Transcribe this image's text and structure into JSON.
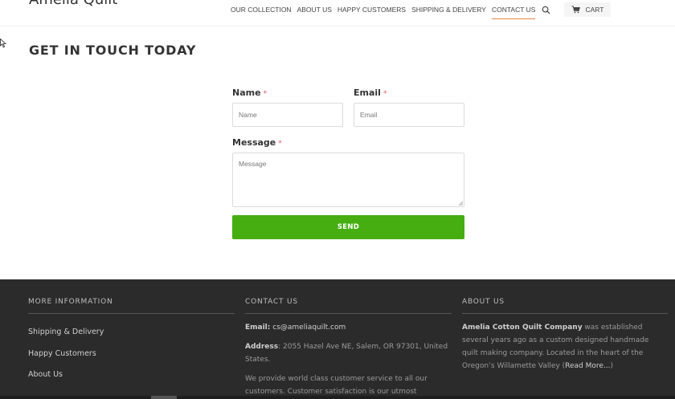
{
  "header": {
    "logo": "Amelia Quilt",
    "nav": [
      {
        "label": "OUR COLLECTION"
      },
      {
        "label": "ABOUT US"
      },
      {
        "label": "HAPPY CUSTOMERS"
      },
      {
        "label": "SHIPPING & DELIVERY"
      },
      {
        "label": "CONTACT US"
      }
    ],
    "cart_label": "CART",
    "accent_color": "#e9864c"
  },
  "page": {
    "title": "GET IN TOUCH TODAY"
  },
  "form": {
    "name_label": "Name",
    "name_placeholder": "Name",
    "email_label": "Email",
    "email_placeholder": "Email",
    "message_label": "Message",
    "message_placeholder": "Message",
    "required_mark": "*",
    "send_label": "SEND",
    "button_color": "#46ae10"
  },
  "footer": {
    "more_info": {
      "heading": "MORE INFORMATION",
      "links": [
        "Shipping & Delivery",
        "Happy Customers",
        "About Us"
      ]
    },
    "contact": {
      "heading": "CONTACT US",
      "email_label": "Email:",
      "email": "cs@ameliaquilt.com",
      "address_label": "Address",
      "address": ": 2055 Hazel Ave NE, Salem, OR 97301, United States.",
      "service_text": "We provide world class customer service to all our customers. Customer satisfaction is our utmost"
    },
    "about": {
      "heading": "ABOUT US",
      "company": "Amelia Cotton Quilt Company",
      "text": " was established several years ago as a custom designed handmade quilt making company.  Located in the heart of the Oregon’s Willamette Valley (",
      "read_more": "Read More...",
      "close_paren": ")"
    }
  }
}
